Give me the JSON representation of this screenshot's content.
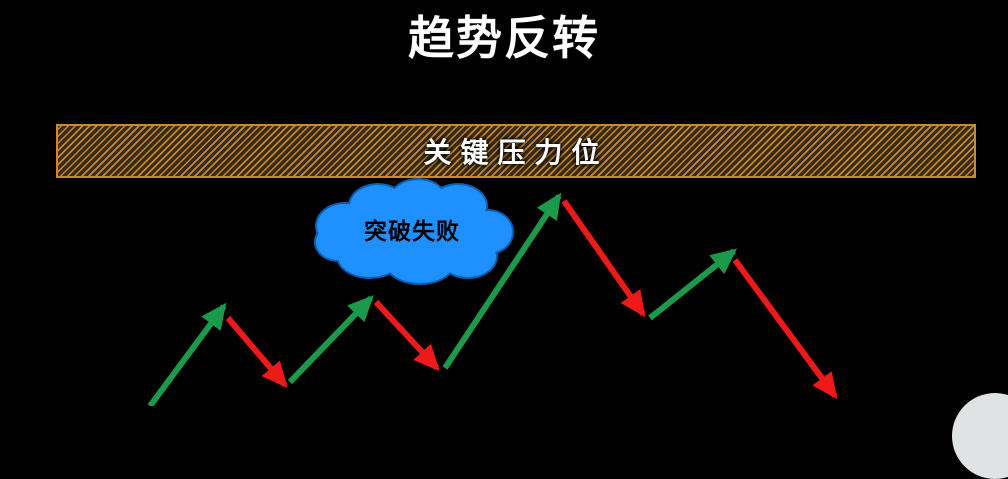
{
  "title": "趋势反转",
  "resistance": {
    "label": "关键压力位"
  },
  "cloud": {
    "label": "突破失败"
  },
  "colors": {
    "background": "#000000",
    "up_arrow": "#1a9a4a",
    "down_arrow": "#ee1a1a",
    "band_stripe": "#c38834",
    "band_border": "#c9892e",
    "cloud_fill": "#1e90ff",
    "cloud_stroke": "#0b5fb4",
    "title_text": "#ffffff"
  },
  "arrows": [
    {
      "direction": "up",
      "color": "green"
    },
    {
      "direction": "down",
      "color": "red"
    },
    {
      "direction": "up",
      "color": "green"
    },
    {
      "direction": "down",
      "color": "red"
    },
    {
      "direction": "up",
      "color": "green"
    },
    {
      "direction": "down",
      "color": "red"
    },
    {
      "direction": "up",
      "color": "green"
    },
    {
      "direction": "down",
      "color": "red"
    }
  ]
}
